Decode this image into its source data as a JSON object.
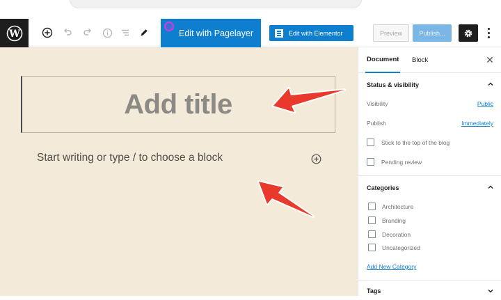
{
  "toolbar": {
    "pagelayer_label": "Edit with Pagelayer",
    "elementor_label": "Edit with Elementor",
    "preview_label": "Preview",
    "publish_label": "Publish...",
    "icons": [
      "wordpress-logo-icon",
      "add-block-icon",
      "undo-icon",
      "redo-icon",
      "info-icon",
      "list-view-icon",
      "tools-pencil-icon",
      "gear-icon",
      "more-vertical-icon"
    ]
  },
  "editor": {
    "title_placeholder": "Add title",
    "block_placeholder": "Start writing or type / to choose a block"
  },
  "sidebar": {
    "tabs": [
      {
        "label": "Document",
        "active": true
      },
      {
        "label": "Block",
        "active": false
      }
    ],
    "status": {
      "heading": "Status & visibility",
      "visibility_label": "Visibility",
      "visibility_value": "Public",
      "publish_label": "Publish",
      "publish_value": "Immediately",
      "sticky_label": "Stick to the top of the blog",
      "pending_label": "Pending review"
    },
    "categories": {
      "heading": "Categories",
      "items": [
        "Architecture",
        "Branding",
        "Decoration",
        "Uncategorized"
      ],
      "add_link": "Add New Category"
    },
    "tags": {
      "heading": "Tags"
    }
  },
  "colors": {
    "accent": "#0e7fcf",
    "canvas_bg": "#f3ead9",
    "arrow": "#e8392c"
  }
}
